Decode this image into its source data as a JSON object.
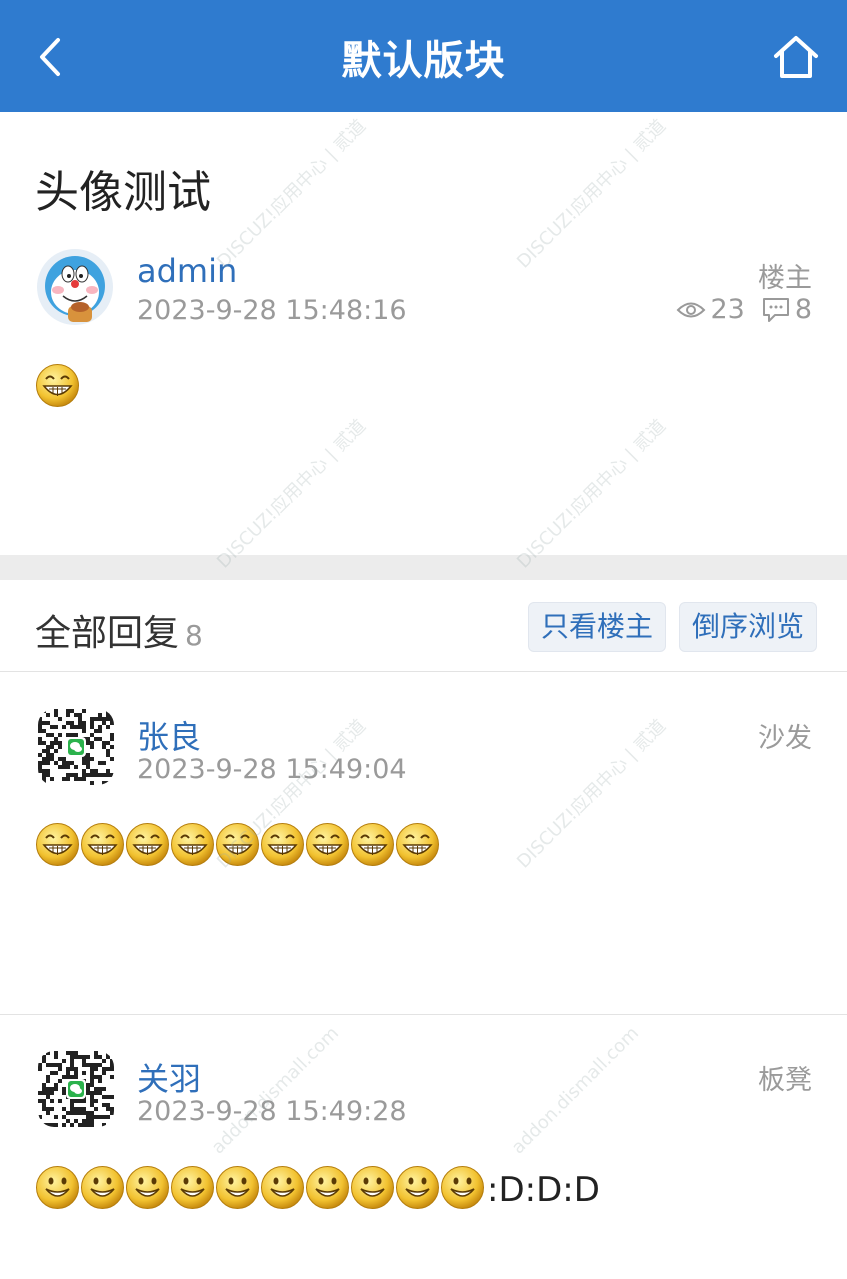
{
  "header": {
    "title": "默认版块",
    "back_icon": "chevron-left-icon",
    "home_icon": "home-icon",
    "color": "#2f7bcf"
  },
  "post": {
    "title": "头像测试",
    "author": "admin",
    "time": "2023-9-28 15:48:16",
    "floor_label": "楼主",
    "views": "23",
    "replies": "8",
    "emoji_count": 1
  },
  "replies_section": {
    "label": "全部回复",
    "count": "8",
    "only_author_label": "只看楼主",
    "reverse_label": "倒序浏览"
  },
  "replies": [
    {
      "author": "张良",
      "time": "2023-9-28 15:49:04",
      "floor_label": "沙发",
      "emoji": "grin",
      "emoji_count": 9,
      "text": ""
    },
    {
      "author": "关羽",
      "time": "2023-9-28 15:49:28",
      "floor_label": "板凳",
      "emoji": "smile",
      "emoji_count": 10,
      "text": ":D:D:D"
    }
  ],
  "watermark": {
    "brand": "DISCUZ!应用中心",
    "domain": "addon.dismall.com",
    "name": "贰道"
  }
}
